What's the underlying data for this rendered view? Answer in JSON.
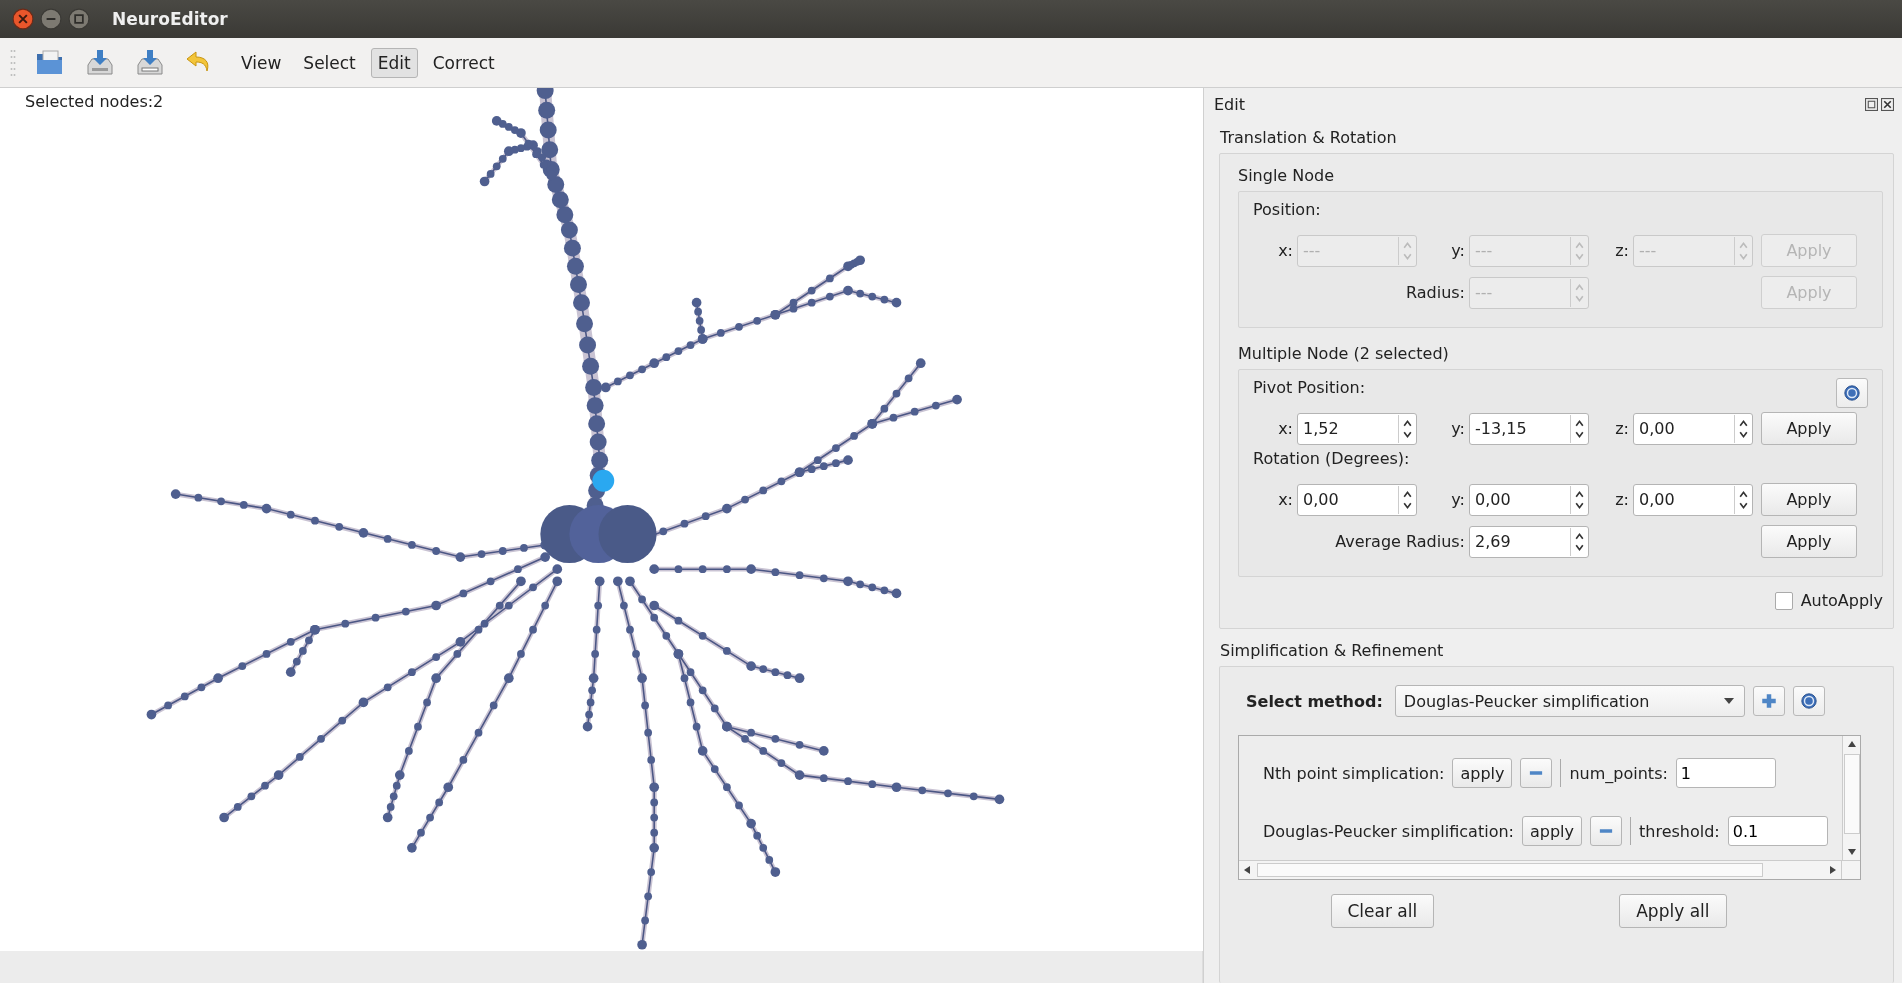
{
  "window": {
    "title": "NeuroEditor"
  },
  "toolbar": {
    "modes": [
      {
        "label": "View",
        "selected": false
      },
      {
        "label": "Select",
        "selected": false
      },
      {
        "label": "Edit",
        "selected": true
      },
      {
        "label": "Correct",
        "selected": false
      }
    ]
  },
  "viewport": {
    "status": "Selected nodes:2"
  },
  "panel": {
    "title": "Edit",
    "translation": {
      "title": "Translation & Rotation",
      "groups": [
        {
          "title": "Single Node",
          "disabled": true,
          "sections": [
            {
              "heading": "Position:",
              "help": false,
              "rows": [
                {
                  "fields": [
                    {
                      "label": "x:",
                      "value": "---"
                    },
                    {
                      "label": "y:",
                      "value": "---"
                    },
                    {
                      "label": "z:",
                      "value": "---"
                    }
                  ],
                  "button": "Apply"
                },
                {
                  "fields": [
                    {
                      "label": "Radius:",
                      "value": "---"
                    }
                  ],
                  "button": "Apply"
                }
              ]
            }
          ]
        },
        {
          "title": "Multiple Node (2 selected)",
          "disabled": false,
          "sections": [
            {
              "heading": "Pivot Position:",
              "help": true,
              "rows": [
                {
                  "fields": [
                    {
                      "label": "x:",
                      "value": "1,52"
                    },
                    {
                      "label": "y:",
                      "value": "-13,15"
                    },
                    {
                      "label": "z:",
                      "value": "0,00"
                    }
                  ],
                  "button": "Apply"
                }
              ]
            },
            {
              "heading": "Rotation (Degrees):",
              "help": false,
              "rows": [
                {
                  "fields": [
                    {
                      "label": "x:",
                      "value": "0,00"
                    },
                    {
                      "label": "y:",
                      "value": "0,00"
                    },
                    {
                      "label": "z:",
                      "value": "0,00"
                    }
                  ],
                  "button": "Apply"
                },
                {
                  "fields": [
                    {
                      "label": "Average Radius:",
                      "value": "2,69"
                    }
                  ],
                  "button": "Apply"
                }
              ]
            }
          ]
        }
      ],
      "auto_apply": {
        "label": "AutoApply",
        "checked": false
      }
    },
    "simplification": {
      "title": "Simplification & Refinement",
      "method_label": "Select method:",
      "method": "Douglas-Peucker simplification",
      "steps": [
        {
          "label": "Nth point simplication:",
          "button": "apply",
          "param_label": "num_points:",
          "param_value": "1"
        },
        {
          "label": "Douglas-Peucker simplification:",
          "button": "apply",
          "param_label": "threshold:",
          "param_value": "0.1"
        }
      ],
      "buttons": [
        "Clear all",
        "Apply all"
      ]
    }
  }
}
